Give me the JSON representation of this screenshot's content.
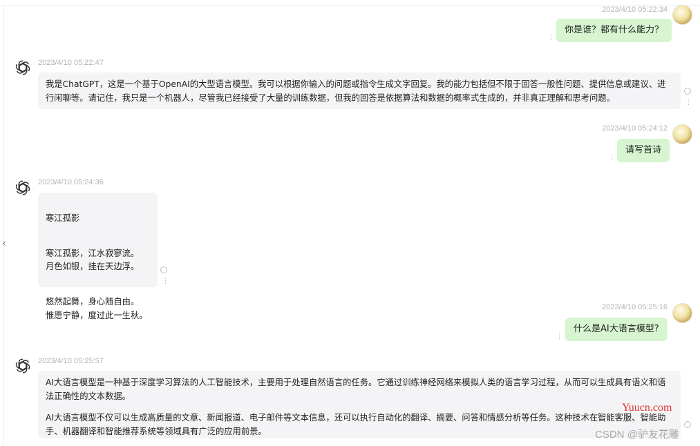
{
  "messages": [
    {
      "role": "user",
      "time": "2023/4/10 05:22:34",
      "text": "你是谁？都有什么能力？"
    },
    {
      "role": "assistant",
      "time": "2023/4/10 05:22:47",
      "paragraphs": [
        "我是ChatGPT，这是一个基于OpenAI的大型语言模型。我可以根据你输入的问题或指令生成文字回复。我的能力包括但不限于回答一般性问题、提供信息或建议、进行闲聊等。请记住，我只是一个机器人，尽管我已经接受了大量的训练数据，但我的回答是依据算法和数据的概率式生成的，并非真正理解和思考问题。"
      ]
    },
    {
      "role": "user",
      "time": "2023/4/10 05:24:12",
      "text": "请写首诗"
    },
    {
      "role": "assistant",
      "time": "2023/4/10 05:24:36",
      "paragraphs": [
        "寒江孤影",
        "寒江孤影，江水寂寥流。\n月色如银，挂在天边浮。",
        "悠然起舞，身心随自由。\n惟愿宁静，度过此一生秋。"
      ]
    },
    {
      "role": "user",
      "time": "2023/4/10 05:25:16",
      "text": "什么是AI大语言模型?"
    },
    {
      "role": "assistant",
      "time": "2023/4/10 05:25:57",
      "paragraphs": [
        "AI大语言模型是一种基于深度学习算法的人工智能技术，主要用于处理自然语言的任务。它通过训练神经网络来模拟人类的语言学习过程，从而可以生成具有语义和语法正确性的文本数据。",
        "AI大语言模型不仅可以生成高质量的文章、新闻报道、电子邮件等文本信息，还可以执行自动化的翻译、摘要、问答和情感分析等任务。这种技术在智能客服、智能助手、机器翻译和智能推荐系统等领域具有广泛的应用前景。"
      ]
    }
  ],
  "watermark": {
    "site": "Yuucn.com",
    "author": "CSDN @驴友花雕"
  },
  "icons": {
    "collapse": "chevron-left-icon",
    "bot": "openai-logo-icon",
    "more": "vertical-dots-icon",
    "select": "radio-circle-icon"
  }
}
